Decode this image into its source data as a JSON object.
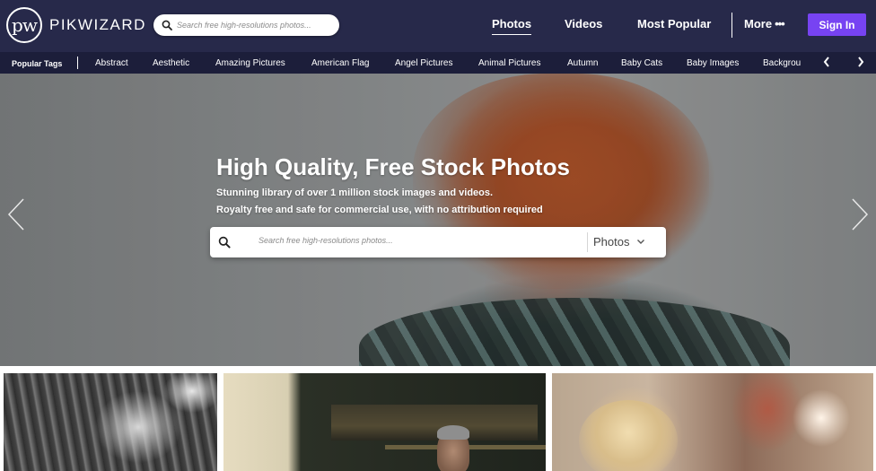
{
  "brand": {
    "logo_mark": "pw",
    "name": "PIKWIZARD"
  },
  "top_search": {
    "placeholder": "Search free high-resolutions photos..."
  },
  "nav": {
    "links": [
      "Photos",
      "Videos",
      "Most Popular",
      "More"
    ],
    "active": "Photos",
    "more_icon": "ellipsis-icon",
    "signin_label": "Sign In"
  },
  "tags": {
    "heading": "Popular Tags",
    "items": [
      "Abstract",
      "Aesthetic",
      "Amazing Pictures",
      "American Flag",
      "Angel Pictures",
      "Animal Pictures",
      "Autumn",
      "Baby Cats",
      "Baby Images",
      "Backgrou"
    ],
    "prev_icon": "chevron-left-icon",
    "next_icon": "chevron-right-icon"
  },
  "hero": {
    "title": "High Quality, Free Stock Photos",
    "subtitle_line1": "Stunning library of over 1 million stock images and videos.",
    "subtitle_line2": "Royalty free and safe for commercial use, with no attribution required",
    "search_placeholder": "Search free high-resolutions photos...",
    "search_type": "Photos",
    "prev_icon": "chevron-left-icon",
    "next_icon": "chevron-right-icon"
  },
  "colors": {
    "nav_bg": "#27294a",
    "tagbar_bg": "#1c1e3a",
    "signin_bg": "#7743f2"
  }
}
